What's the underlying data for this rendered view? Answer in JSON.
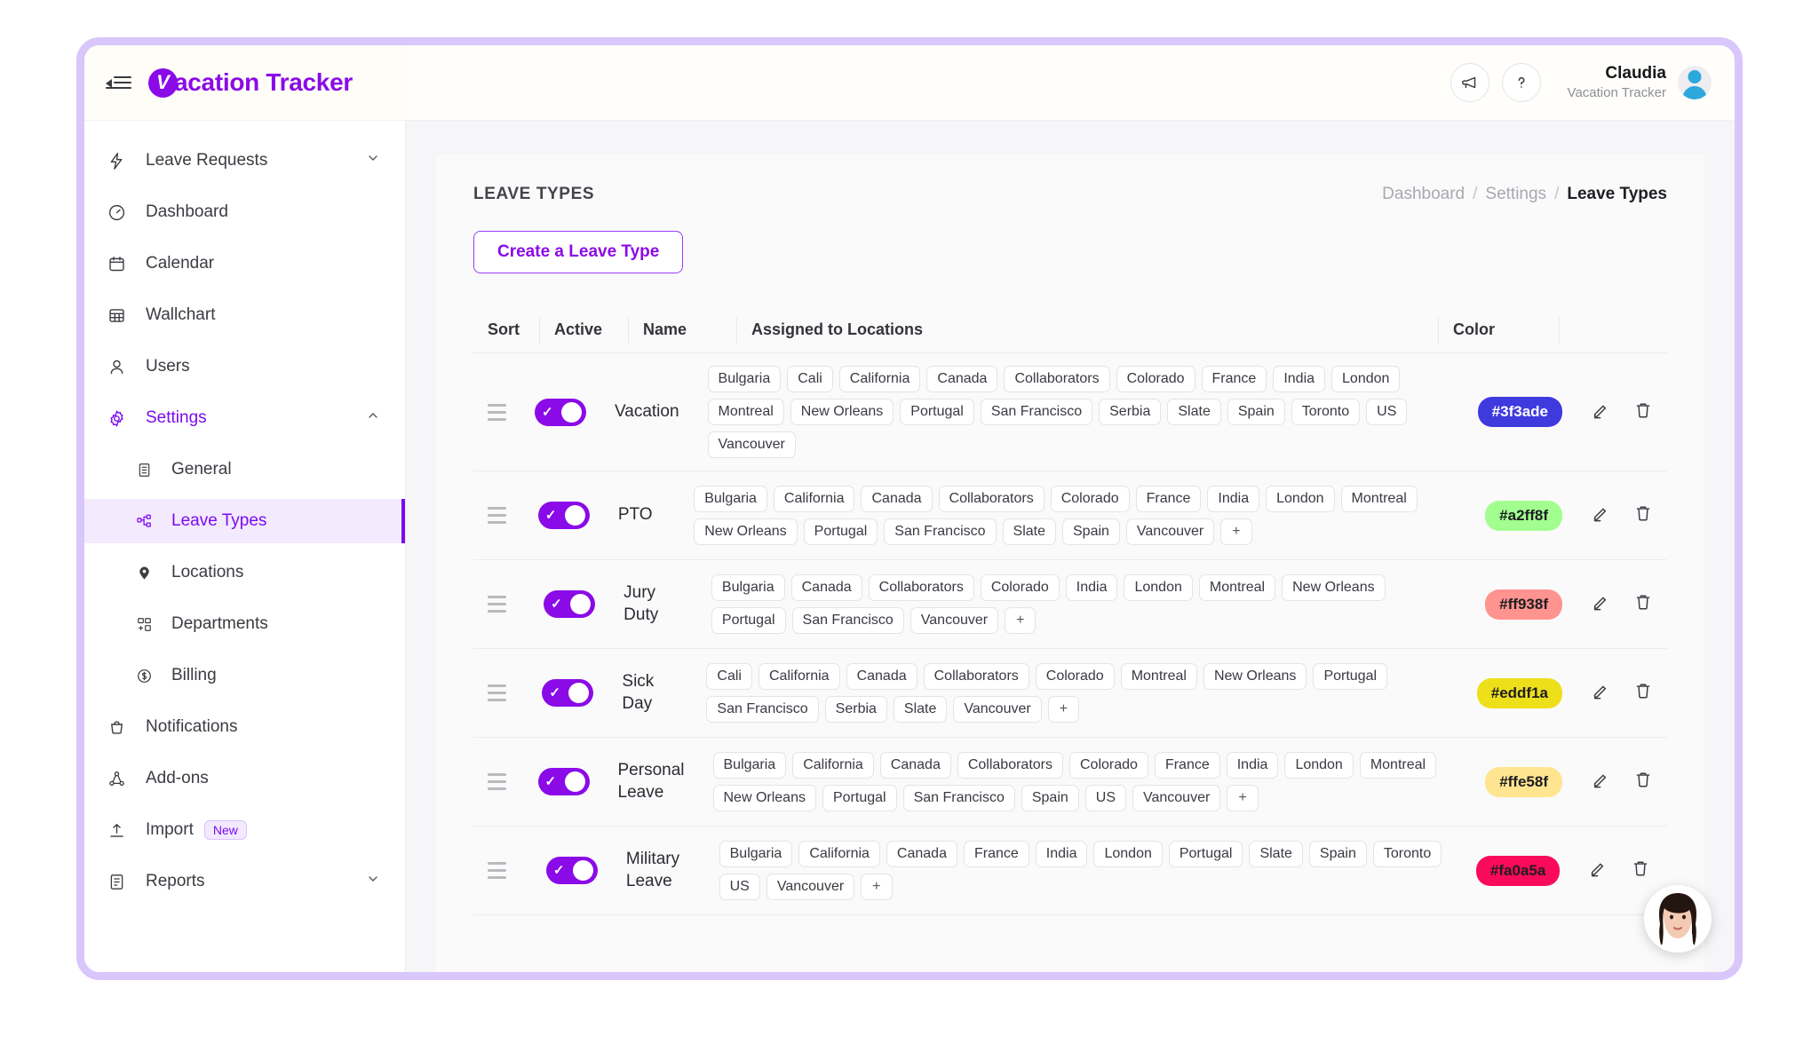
{
  "header": {
    "brand_letter": "V",
    "brand_name": "acation Tracker",
    "collapse_icon": "collapse-sidebar-icon",
    "announce_icon": "megaphone-icon",
    "help_icon": "question-mark-icon",
    "user_name": "Claudia",
    "user_org": "Vacation Tracker"
  },
  "sidebar": {
    "items": [
      {
        "label": "Leave Requests",
        "icon": "bolt-icon",
        "chevron": "chevron-down",
        "active": false
      },
      {
        "label": "Dashboard",
        "icon": "gauge-icon",
        "active": false
      },
      {
        "label": "Calendar",
        "icon": "calendar-icon",
        "active": false
      },
      {
        "label": "Wallchart",
        "icon": "grid-table-icon",
        "active": false
      },
      {
        "label": "Users",
        "icon": "user-icon",
        "active": false
      },
      {
        "label": "Settings",
        "icon": "gear-icon",
        "chevron": "chevron-up",
        "active": true
      }
    ],
    "settings_children": [
      {
        "label": "General",
        "icon": "document-icon",
        "selected": false
      },
      {
        "label": "Leave Types",
        "icon": "nodes-icon",
        "selected": true
      },
      {
        "label": "Locations",
        "icon": "pin-icon",
        "selected": false
      },
      {
        "label": "Departments",
        "icon": "departments-icon",
        "selected": false
      },
      {
        "label": "Billing",
        "icon": "dollar-circle-icon",
        "selected": false
      }
    ],
    "items_bottom": [
      {
        "label": "Notifications",
        "icon": "bell-icon"
      },
      {
        "label": "Add-ons",
        "icon": "add-ons-icon"
      },
      {
        "label": "Import",
        "icon": "upload-icon",
        "badge": "New"
      },
      {
        "label": "Reports",
        "icon": "report-icon",
        "chevron": "chevron-down"
      }
    ]
  },
  "main": {
    "page_title": "LEAVE TYPES",
    "breadcrumb": {
      "items": [
        "Dashboard",
        "Settings"
      ],
      "separator": "/",
      "current": "Leave Types"
    },
    "create_button": "Create a Leave Type",
    "table": {
      "headers": [
        "Sort",
        "Active",
        "Name",
        "Assigned to Locations",
        "Color",
        ""
      ],
      "add_tag_label": "+",
      "edit_icon": "pencil-icon",
      "delete_icon": "trash-icon",
      "drag_icon": "drag-handle-icon",
      "rows": [
        {
          "name": "Vacation",
          "active": true,
          "color": "#3f3ade",
          "color_text": "#ffffff",
          "locations": [
            "Bulgaria",
            "Cali",
            "California",
            "Canada",
            "Collaborators",
            "Colorado",
            "France",
            "India",
            "London",
            "Montreal",
            "New Orleans",
            "Portugal",
            "San Francisco",
            "Serbia",
            "Slate",
            "Spain",
            "Toronto",
            "US",
            "Vancouver"
          ],
          "has_add": false
        },
        {
          "name": "PTO",
          "active": true,
          "color": "#a2ff8f",
          "color_text": "#1d1d22",
          "locations": [
            "Bulgaria",
            "California",
            "Canada",
            "Collaborators",
            "Colorado",
            "France",
            "India",
            "London",
            "Montreal",
            "New Orleans",
            "Portugal",
            "San Francisco",
            "Slate",
            "Spain",
            "Vancouver"
          ],
          "has_add": true
        },
        {
          "name": "Jury Duty",
          "active": true,
          "color": "#ff938f",
          "color_text": "#1d1d22",
          "locations": [
            "Bulgaria",
            "Canada",
            "Collaborators",
            "Colorado",
            "India",
            "London",
            "Montreal",
            "New Orleans",
            "Portugal",
            "San Francisco",
            "Vancouver"
          ],
          "has_add": true
        },
        {
          "name": "Sick Day",
          "active": true,
          "color": "#eddf1a",
          "color_text": "#1d1d22",
          "locations": [
            "Cali",
            "California",
            "Canada",
            "Collaborators",
            "Colorado",
            "Montreal",
            "New Orleans",
            "Portugal",
            "San Francisco",
            "Serbia",
            "Slate",
            "Vancouver"
          ],
          "has_add": true
        },
        {
          "name": "Personal Leave",
          "active": true,
          "color": "#ffe58f",
          "color_text": "#1d1d22",
          "locations": [
            "Bulgaria",
            "California",
            "Canada",
            "Collaborators",
            "Colorado",
            "France",
            "India",
            "London",
            "Montreal",
            "New Orleans",
            "Portugal",
            "San Francisco",
            "Spain",
            "US",
            "Vancouver"
          ],
          "has_add": true
        },
        {
          "name": "Military Leave",
          "active": true,
          "color": "#fa0a5a",
          "color_text": "#1d1d22",
          "locations": [
            "Bulgaria",
            "California",
            "Canada",
            "France",
            "India",
            "London",
            "Portugal",
            "Slate",
            "Spain",
            "Toronto",
            "US",
            "Vancouver"
          ],
          "has_add": true
        }
      ]
    }
  },
  "colors": {
    "brand_purple": "#8b0ae8",
    "accent_purple": "#7a0bf0",
    "frame_lavender": "#d9c6fb",
    "selected_bg": "#f3eafe"
  },
  "float_widget": {
    "icon": "person-avatar-photo"
  }
}
